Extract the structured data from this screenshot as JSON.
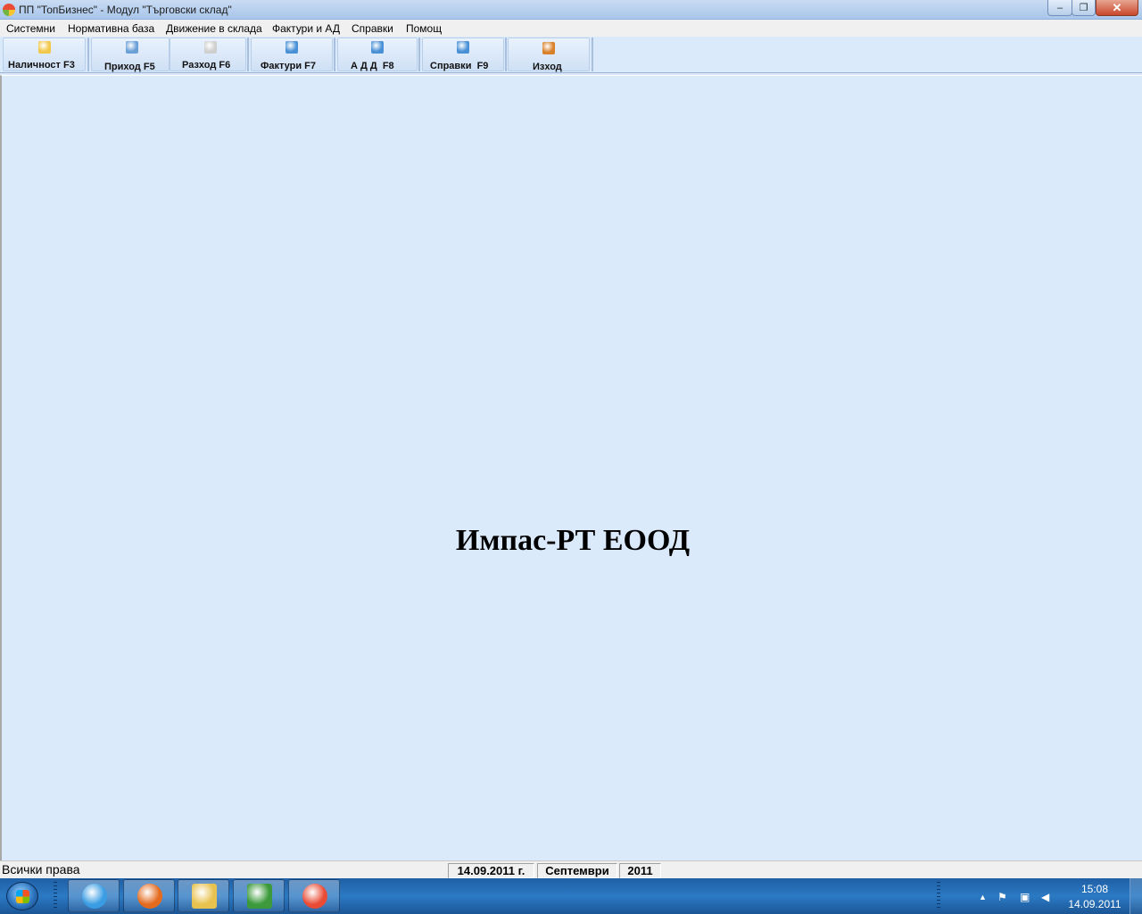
{
  "window": {
    "title": "ПП \"ТопБизнес\" - Модул \"Търговски склад\"",
    "minimize_glyph": "‒",
    "maximize_glyph": "❐",
    "close_glyph": "✕"
  },
  "menu": [
    {
      "label": "Системни"
    },
    {
      "label": "Нормативна база"
    },
    {
      "label": "Движение в склада"
    },
    {
      "label": "Фактури и АД"
    },
    {
      "label": "Справки"
    },
    {
      "label": "Помощ"
    }
  ],
  "toolbar": [
    {
      "label": "Наличност F3",
      "icon": "folder-icon",
      "color": "#f2c84b"
    },
    {
      "label": "Приход F5",
      "icon": "document-icon",
      "color": "#6b9fd8"
    },
    {
      "label": "Разход F6",
      "icon": "pen-document-icon",
      "color": "#cfcfcf"
    },
    {
      "label": "Фактури F7",
      "icon": "invoice-icon",
      "color": "#4a90d6"
    },
    {
      "label": "А Д Д  F8",
      "icon": "add-document-icon",
      "color": "#4a90d6"
    },
    {
      "label": "Справки  F9",
      "icon": "report-icon",
      "color": "#4a90d6"
    },
    {
      "label": "Изход",
      "icon": "exit-icon",
      "color": "#d9812a"
    }
  ],
  "main": {
    "company_name": "Импас-РТ ЕООД"
  },
  "status": {
    "rights": "Всички права",
    "date": "14.09.2011 г.",
    "month": "Септември",
    "year": "2011"
  },
  "taskbar": {
    "apps": [
      {
        "icon": "internet-explorer-icon",
        "color": "#3a9de3"
      },
      {
        "icon": "firefox-icon",
        "color": "#e36a1e"
      },
      {
        "icon": "file-explorer-icon",
        "color": "#e8c24f"
      },
      {
        "icon": "network-app-icon",
        "color": "#3c9a3c"
      },
      {
        "icon": "topbiznes-icon",
        "color": "#e94b35"
      }
    ],
    "clock_time": "15:08",
    "clock_date": "14.09.2011"
  }
}
